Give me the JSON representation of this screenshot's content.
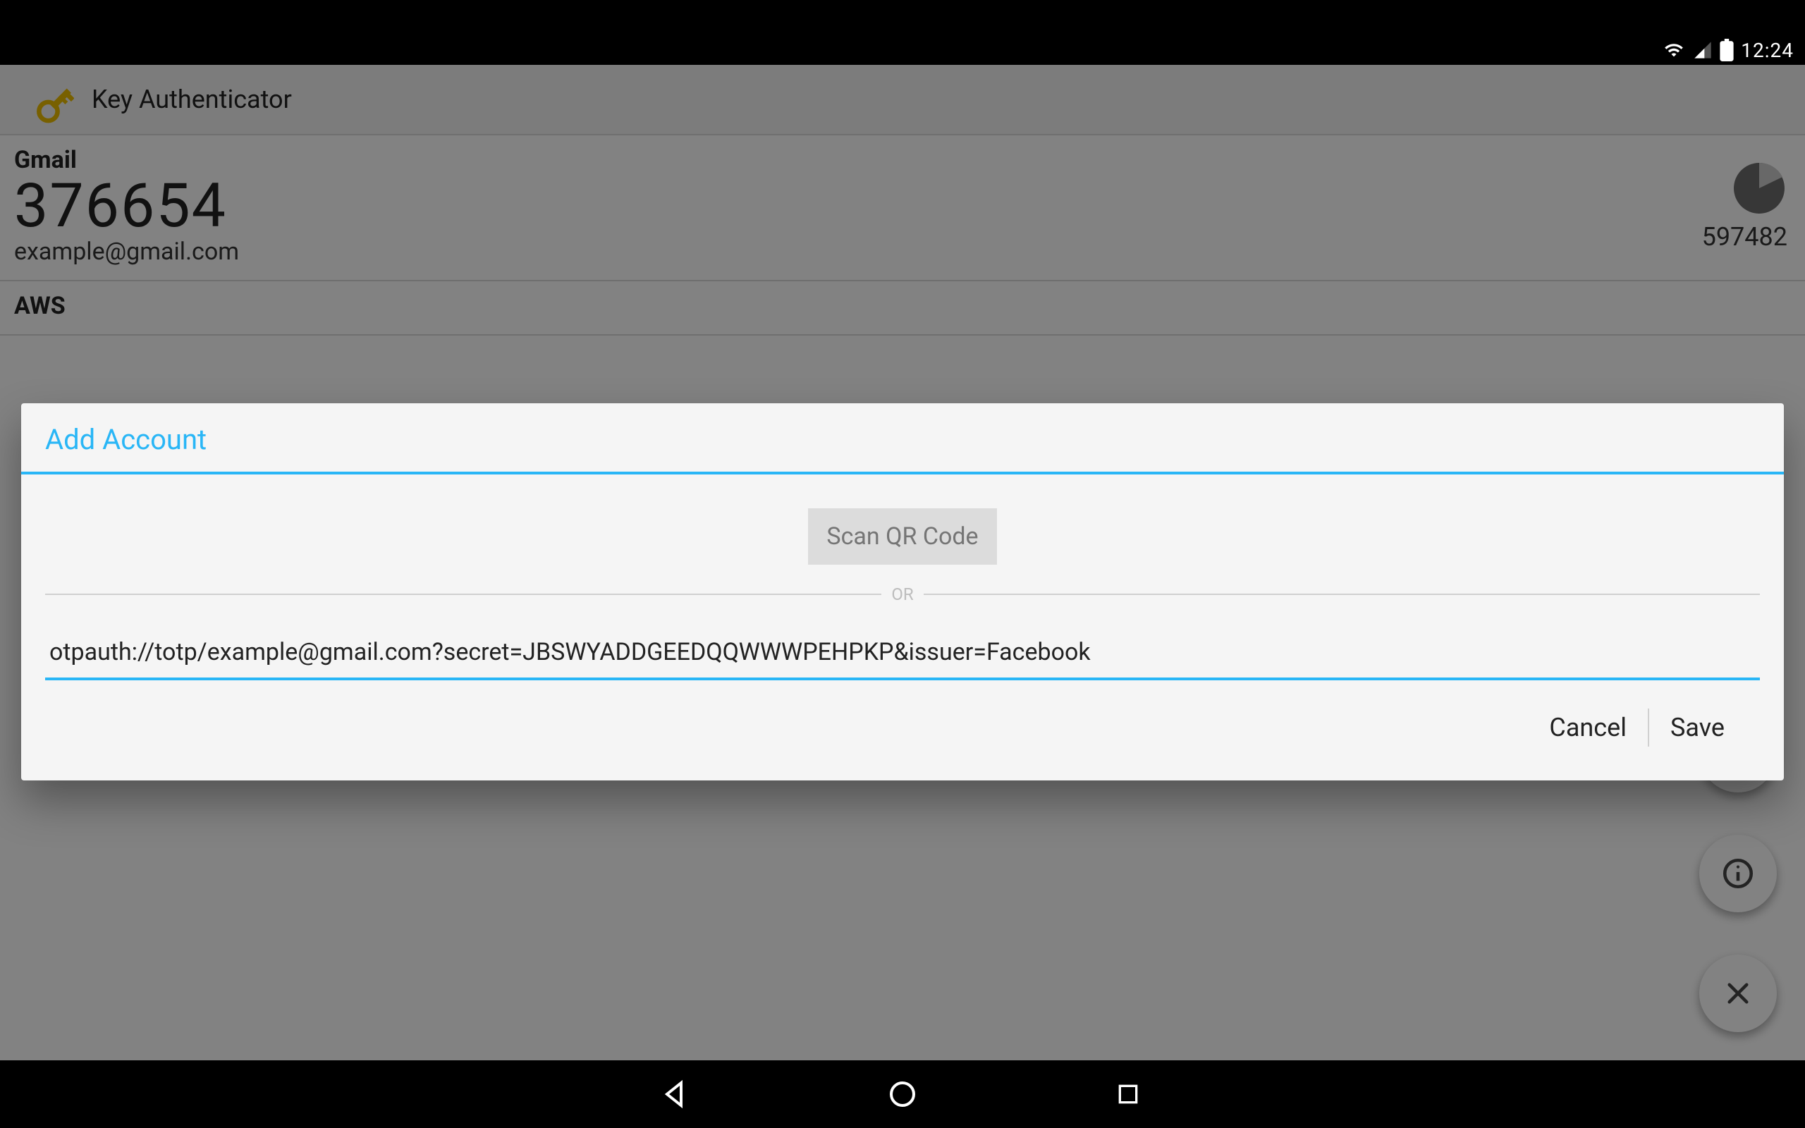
{
  "status_bar": {
    "time": "12:24"
  },
  "app": {
    "title": "Key Authenticator"
  },
  "accounts": [
    {
      "name": "Gmail",
      "code": "376654",
      "email": "example@gmail.com",
      "right_code": "597482"
    },
    {
      "name": "AWS",
      "code": "",
      "email": "",
      "right_code": ""
    }
  ],
  "dialog": {
    "title": "Add Account",
    "scan_label": "Scan QR Code",
    "or_label": "OR",
    "uri_value": "otpauth://totp/example@gmail.com?secret=JBSWYADDGEEDQQWWWPEHPKP&issuer=Facebook",
    "cancel_label": "Cancel",
    "save_label": "Save"
  }
}
